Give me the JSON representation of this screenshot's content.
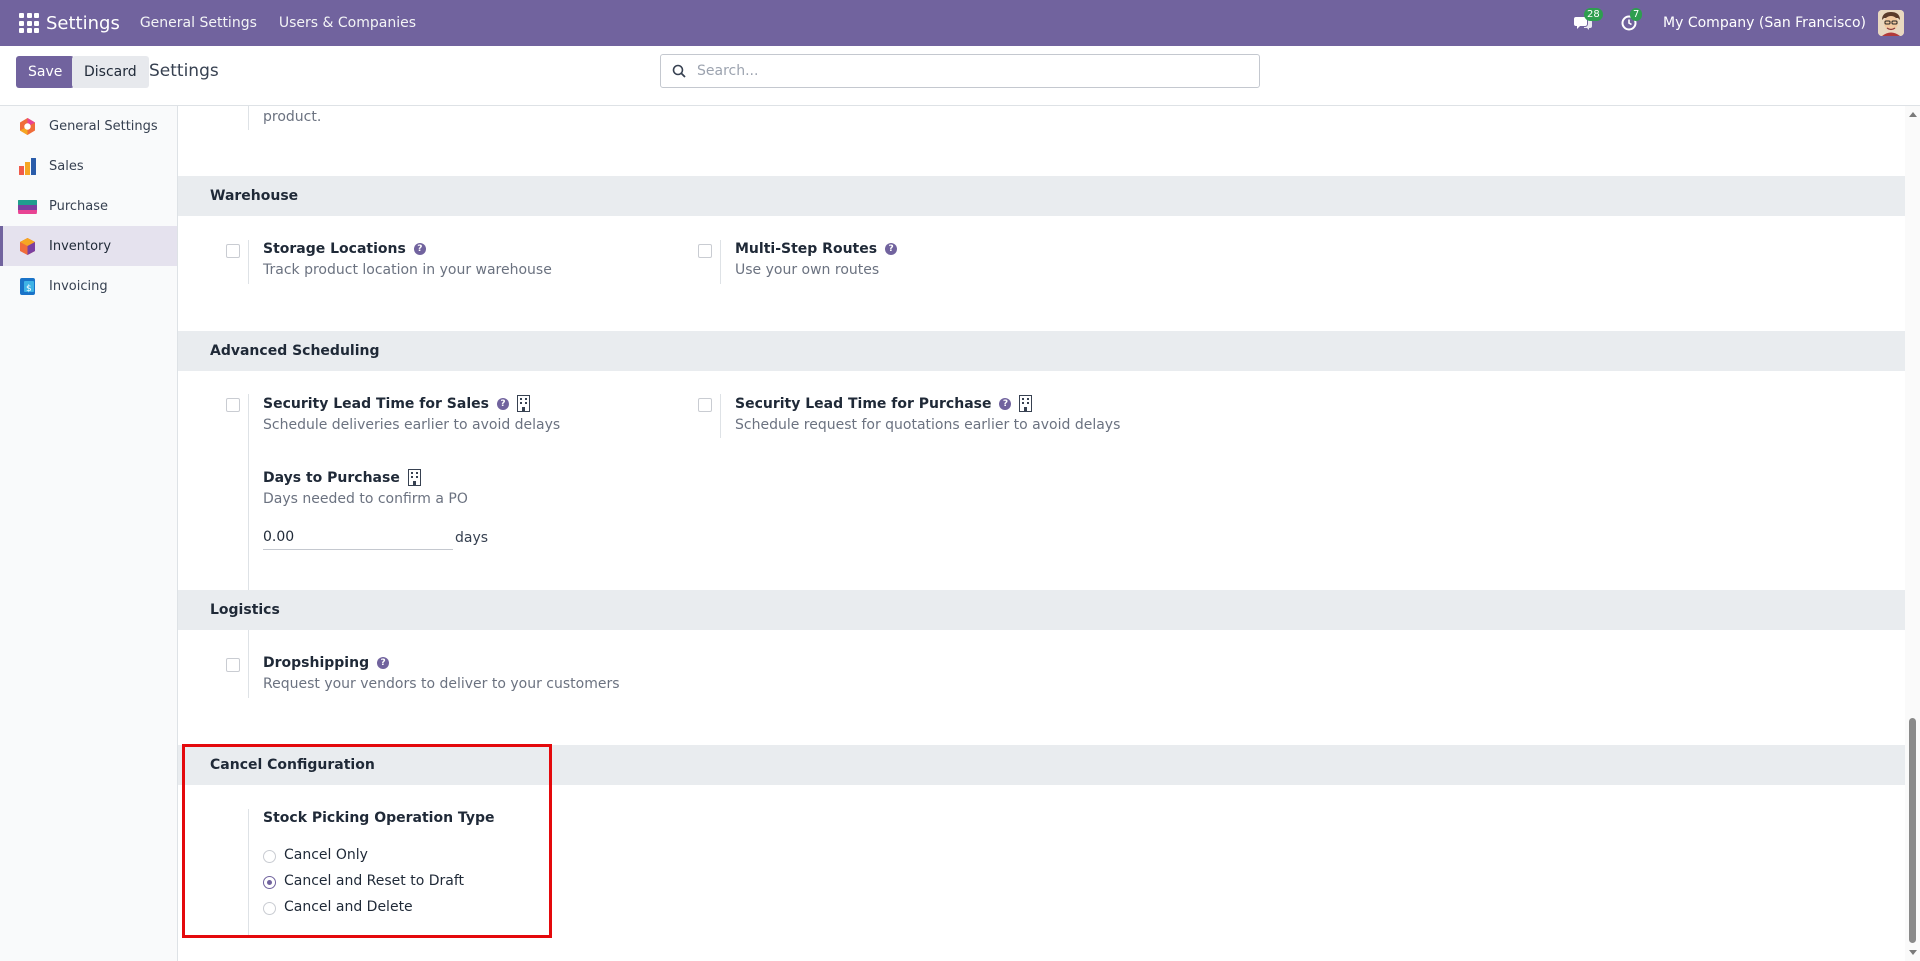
{
  "navbar": {
    "brand": "Settings",
    "menus": [
      "General Settings",
      "Users & Companies"
    ],
    "messages_count": "28",
    "activities_count": "7",
    "company": "My Company (San Francisco)",
    "accent_color": "#71639e"
  },
  "control_panel": {
    "save_label": "Save",
    "discard_label": "Discard",
    "breadcrumb": "Settings",
    "search_placeholder": "Search..."
  },
  "sidebar": {
    "items": [
      {
        "label": "General Settings",
        "icon": "general-settings-icon",
        "active": false
      },
      {
        "label": "Sales",
        "icon": "sales-icon",
        "active": false
      },
      {
        "label": "Purchase",
        "icon": "purchase-icon",
        "active": false
      },
      {
        "label": "Inventory",
        "icon": "inventory-icon",
        "active": true
      },
      {
        "label": "Invoicing",
        "icon": "invoicing-icon",
        "active": false
      }
    ]
  },
  "content": {
    "truncated_text": "product.",
    "warehouse": {
      "title": "Warehouse",
      "storage_locations": {
        "title": "Storage Locations",
        "desc": "Track product location in your warehouse",
        "checked": false
      },
      "multi_step_routes": {
        "title": "Multi-Step Routes",
        "desc": "Use your own routes",
        "checked": false
      }
    },
    "advanced_scheduling": {
      "title": "Advanced Scheduling",
      "lead_sales": {
        "title": "Security Lead Time for Sales",
        "desc": "Schedule deliveries earlier to avoid delays",
        "checked": false
      },
      "lead_purchase": {
        "title": "Security Lead Time for Purchase",
        "desc": "Schedule request for quotations earlier to avoid delays",
        "checked": false
      },
      "days_to_purchase": {
        "title": "Days to Purchase",
        "desc": "Days needed to confirm a PO",
        "value": "0.00",
        "unit": "days"
      }
    },
    "logistics": {
      "title": "Logistics",
      "dropshipping": {
        "title": "Dropshipping",
        "desc": "Request your vendors to deliver to your customers",
        "checked": false
      }
    },
    "cancel_configuration": {
      "title": "Cancel Configuration",
      "field_label": "Stock Picking Operation Type",
      "options": [
        {
          "label": "Cancel Only",
          "checked": false
        },
        {
          "label": "Cancel and Reset to Draft",
          "checked": true
        },
        {
          "label": "Cancel and Delete",
          "checked": false
        }
      ],
      "highlight_color": "#e4090c"
    }
  }
}
